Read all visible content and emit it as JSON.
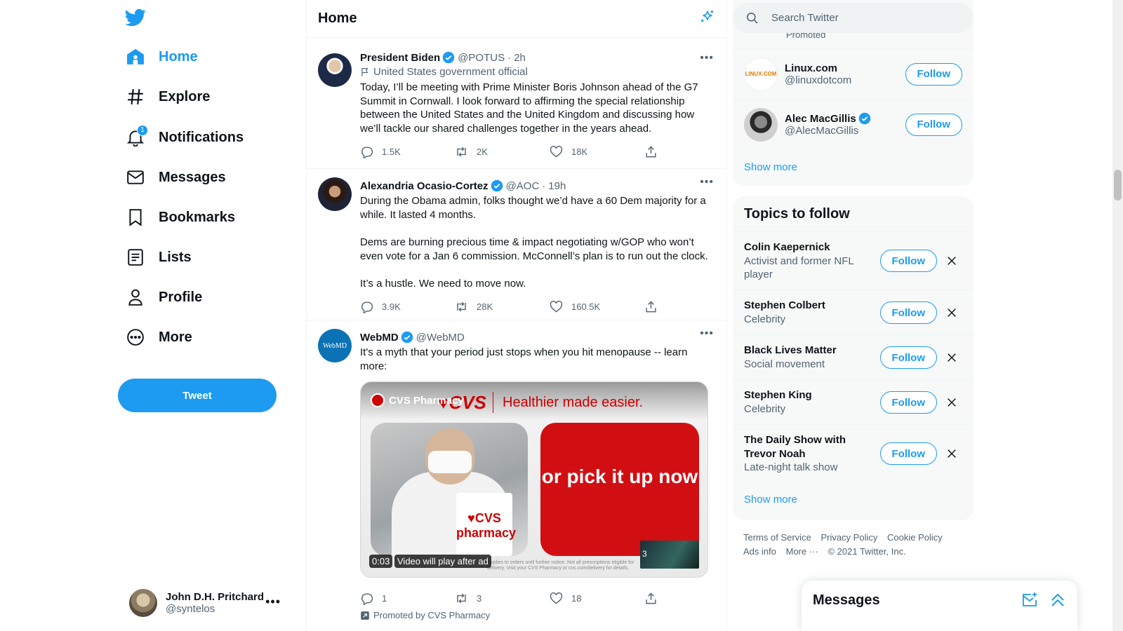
{
  "colors": {
    "accent": "#1d9bf0",
    "text": "#0f1419",
    "muted": "#536471",
    "cvs_red": "#cc0000"
  },
  "nav": {
    "logo_icon": "twitter-bird-icon",
    "items": [
      {
        "label": "Home",
        "icon": "home-icon",
        "active": true
      },
      {
        "label": "Explore",
        "icon": "hashtag-icon"
      },
      {
        "label": "Notifications",
        "icon": "bell-icon",
        "badge": "1"
      },
      {
        "label": "Messages",
        "icon": "envelope-icon"
      },
      {
        "label": "Bookmarks",
        "icon": "bookmark-icon"
      },
      {
        "label": "Lists",
        "icon": "list-icon"
      },
      {
        "label": "Profile",
        "icon": "person-icon"
      },
      {
        "label": "More",
        "icon": "more-circle-icon"
      }
    ],
    "tweet_button": "Tweet",
    "account": {
      "name": "John D.H. Pritchard",
      "handle": "@syntelos"
    }
  },
  "main": {
    "title": "Home",
    "tweets": [
      {
        "name": "President Biden",
        "handle": "@POTUS",
        "time": "2h",
        "meta": "United States government official",
        "text": "Today, I’ll be meeting with Prime Minister Boris Johnson ahead of the G7 Summit in Cornwall. I look forward to affirming the special relationship between the United States and the United Kingdom and discussing how we’ll tackle our shared challenges together in the years ahead.",
        "replies": "1.5K",
        "retweets": "2K",
        "likes": "18K"
      },
      {
        "name": "Alexandria Ocasio-Cortez",
        "handle": "@AOC",
        "time": "19h",
        "text": "During the Obama admin, folks thought we’d have a 60 Dem majority for a while. It lasted 4 months.\n\nDems are burning precious time & impact negotiating w/GOP who won’t even vote for a Jan 6 commission. McConnell’s plan is to run out the clock.\n\nIt’s a hustle. We need to move now.",
        "replies": "3.9K",
        "retweets": "28K",
        "likes": "160.5K"
      },
      {
        "name": "WebMD",
        "handle": "@WebMD",
        "avatar_text": "WebMD",
        "text": "It's a myth that your period just stops when you hit menopause -- learn more:",
        "media": {
          "source": "CVS Pharmacy",
          "logo": "♥CVS",
          "slogan": "Healthier made easier.",
          "bag_text": "♥CVS pharmacy",
          "panel_text": "or pick it up now",
          "fineprint": "Applies to orders until further notice. Not all prescriptions eligible for delivery. Visit your CVS Pharmacy or cvs.com/delivery for details.",
          "time": "0:03",
          "note": "Video will play after ad",
          "thumb_count": "3"
        },
        "replies": "1",
        "retweets": "3",
        "likes": "18",
        "promoted": "Promoted by CVS Pharmacy"
      }
    ]
  },
  "sidebar": {
    "search_placeholder": "Search Twitter",
    "promoted_stub": "Promoted",
    "who_to_follow": [
      {
        "name": "Linux.com",
        "handle": "@linuxdotcom",
        "avatar_text": "LINUX.COM",
        "verified": false,
        "button": "Follow"
      },
      {
        "name": "Alec MacGillis",
        "handle": "@AlecMacGillis",
        "verified": true,
        "button": "Follow"
      }
    ],
    "who_show_more": "Show more",
    "topics_title": "Topics to follow",
    "topics": [
      {
        "name": "Colin Kaepernick",
        "desc": "Activist and former NFL player",
        "button": "Follow"
      },
      {
        "name": "Stephen Colbert",
        "desc": "Celebrity",
        "button": "Follow"
      },
      {
        "name": "Black Lives Matter",
        "desc": "Social movement",
        "button": "Follow"
      },
      {
        "name": "Stephen King",
        "desc": "Celebrity",
        "button": "Follow"
      },
      {
        "name": "The Daily Show with Trevor Noah",
        "desc": "Late-night talk show",
        "button": "Follow"
      }
    ],
    "topics_show_more": "Show more",
    "footer": {
      "terms": "Terms of Service",
      "privacy": "Privacy Policy",
      "cookie": "Cookie Policy",
      "ads": "Ads info",
      "more": "More ···",
      "copyright": "© 2021 Twitter, Inc."
    }
  },
  "messages_dock": {
    "title": "Messages"
  }
}
